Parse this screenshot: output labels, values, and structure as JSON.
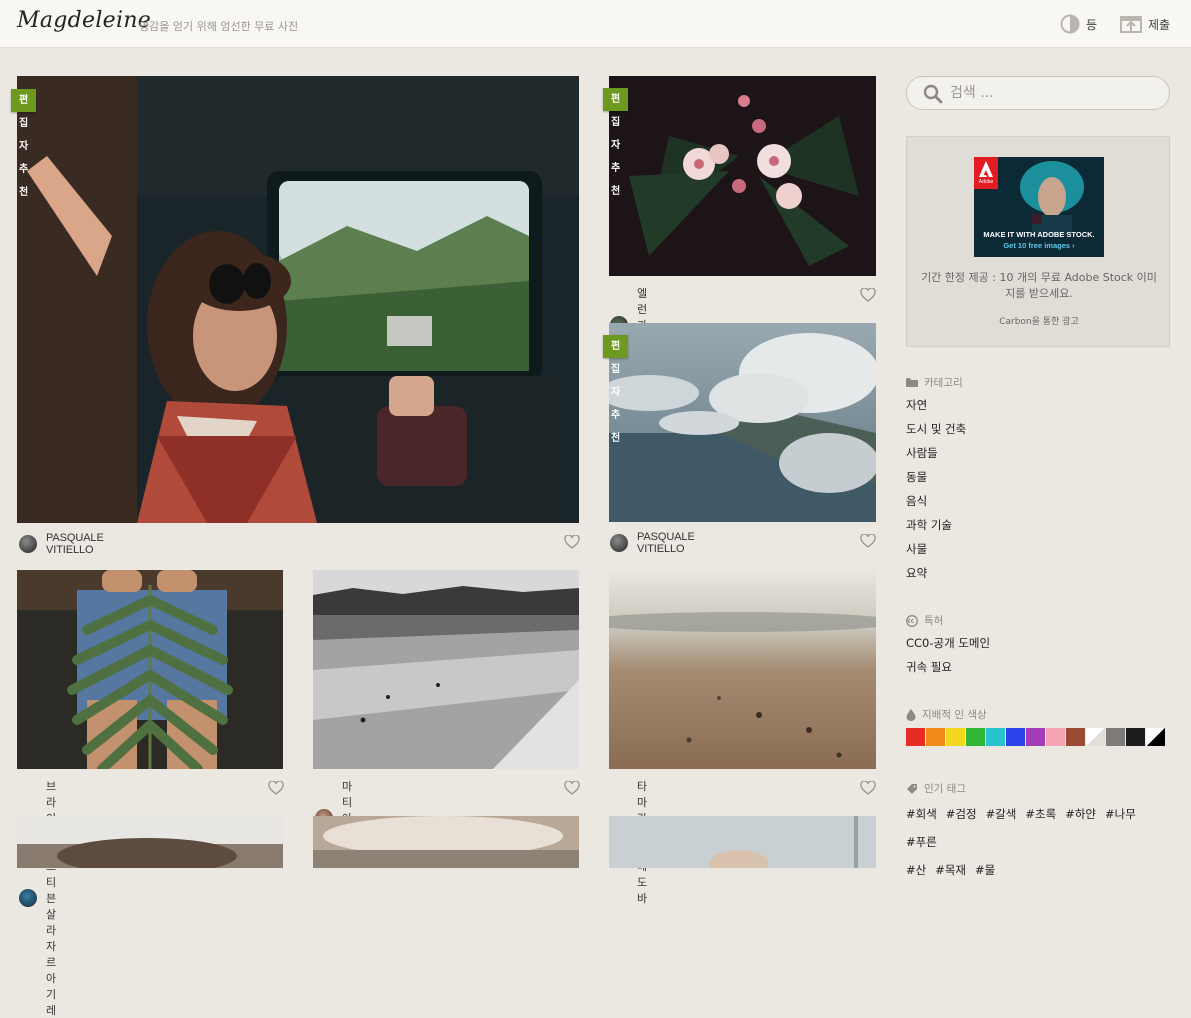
{
  "header": {
    "logo": "Magdeleine",
    "tagline": "영감을 얻기 위해 엄선한 무료 사진",
    "light_label": "등",
    "submit_label": "제출"
  },
  "badges": {
    "editor_pick": "편집자 추천"
  },
  "photos": [
    {
      "credit": "PASQUALE VITIELLO"
    },
    {
      "credit": "엘런 카 벨로"
    },
    {
      "credit": "PASQUALE VITIELLO"
    },
    {
      "credit": "브라이언트 스티븐 살라자르 아기 레"
    },
    {
      "credit": "마티아스 립"
    },
    {
      "credit": "타마라 마호 메도 바"
    }
  ],
  "search": {
    "placeholder": "검색 ..."
  },
  "ad": {
    "brand": "Adobe",
    "headline": "MAKE IT WITH ADOBE STOCK.",
    "cta": "Get 10 free images ›",
    "text": "기간 한정 제공 : 10 개의 무료 Adobe Stock 이미지를 받으세요.",
    "via": "Carbon을 통한 광고"
  },
  "categories": {
    "title": "카테고리",
    "items": [
      "자연",
      "도시 및 건축",
      "사람들",
      "동물",
      "음식",
      "과학 기술",
      "사물",
      "요약"
    ]
  },
  "license": {
    "title": "특허",
    "items": [
      "CC0-공개 도메인",
      "귀속 필요"
    ]
  },
  "colors": {
    "title": "지배적 인 색상",
    "swatches": [
      "#e52d26",
      "#f08a16",
      "#f3d81d",
      "#2fb634",
      "#29c3cf",
      "#2b43e8",
      "#a23db5",
      "#f4a3b2",
      "#9b4a34",
      "#ffffff",
      "#7c7b79",
      "#1d1d1d",
      "#000000"
    ]
  },
  "tags": {
    "title": "인기 태그",
    "items": [
      "#회색",
      "#검정",
      "#갈색",
      "#초록",
      "#하얀",
      "#나무",
      "#푸른",
      "#산",
      "#목재",
      "#물"
    ]
  },
  "theme": {
    "accent": "#6d9a1e",
    "background": "#ebe8e1"
  }
}
